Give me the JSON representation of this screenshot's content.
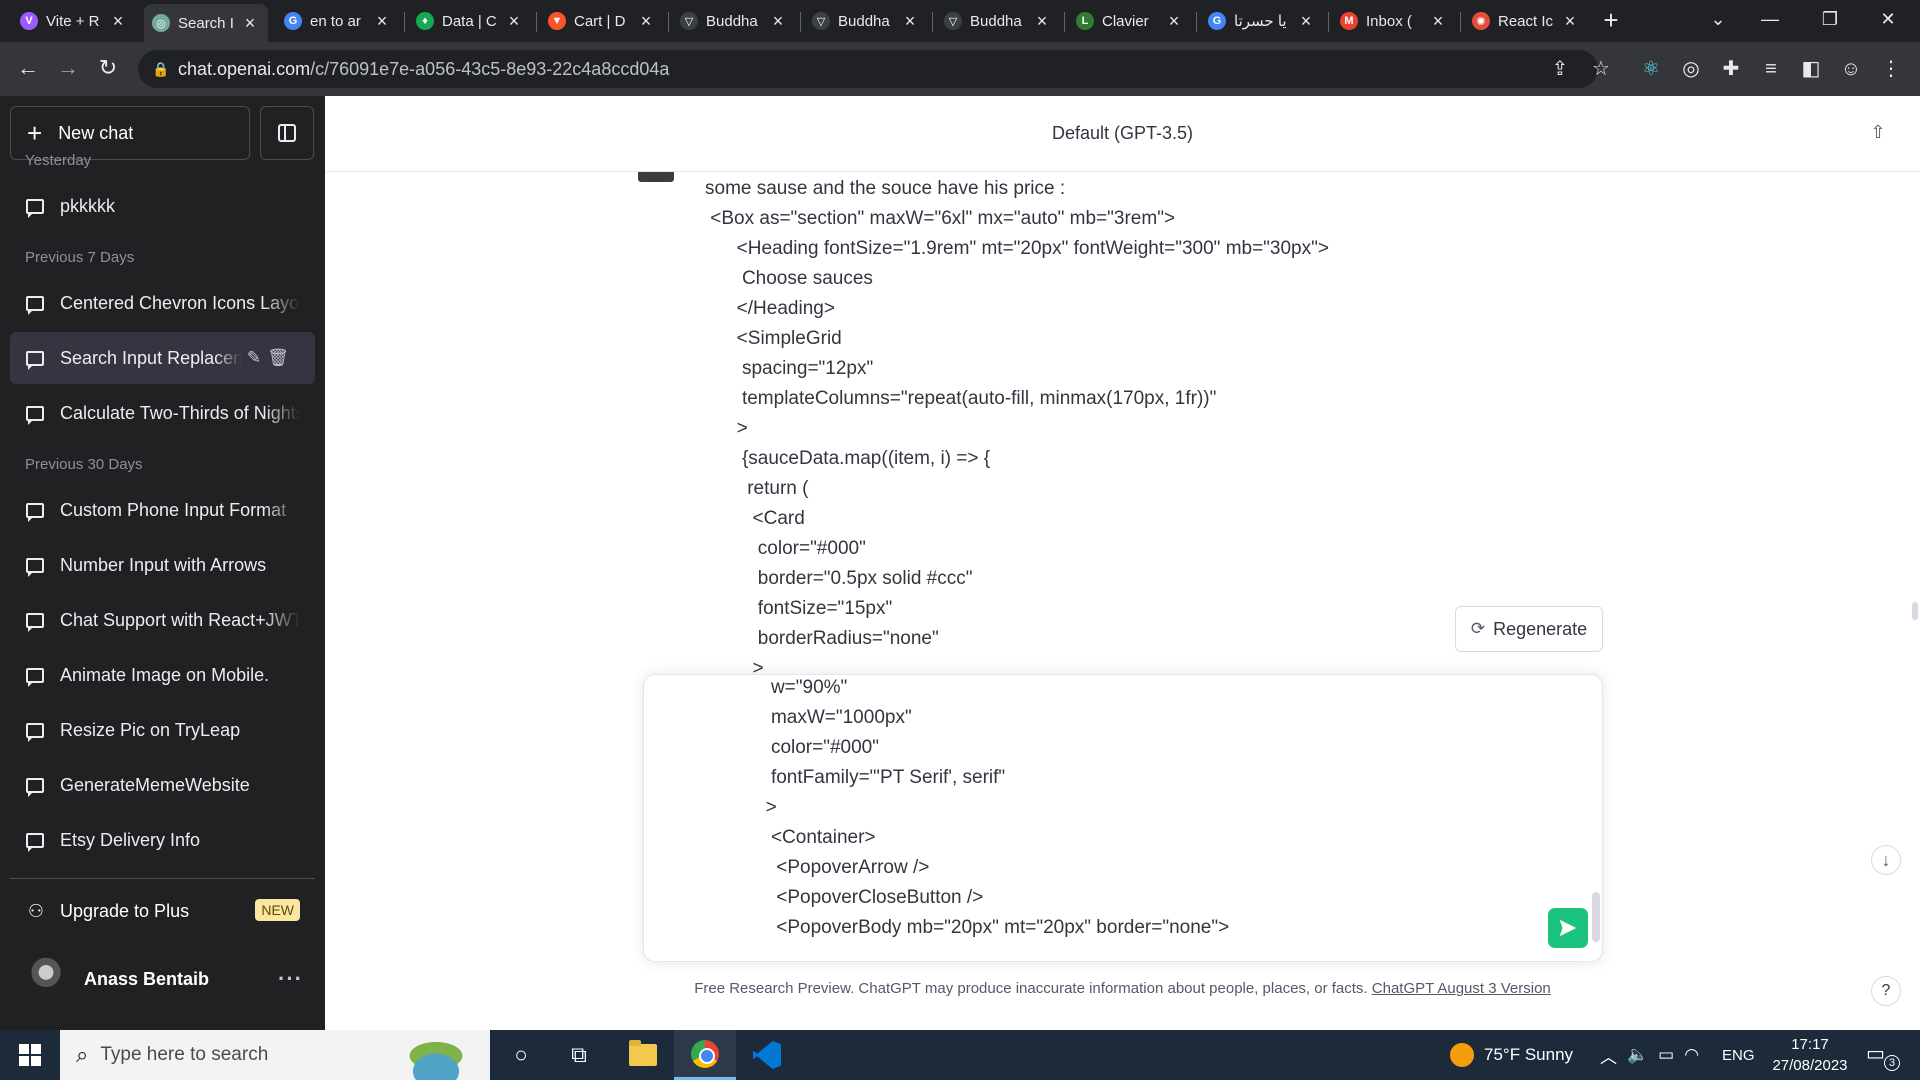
{
  "browser": {
    "tabs": [
      {
        "title": "Vite + R",
        "icon": "vite-icon",
        "color": "#9b5cff",
        "glyph": "V"
      },
      {
        "title": "Search I",
        "icon": "chatgpt-icon",
        "color": "#74aa9c",
        "glyph": "◎"
      },
      {
        "title": "en to ar",
        "icon": "google-icon",
        "color": "#4285f4",
        "glyph": "G"
      },
      {
        "title": "Data | C",
        "icon": "mongodb-icon",
        "color": "#13aa52",
        "glyph": "♦"
      },
      {
        "title": "Cart | D",
        "icon": "brave-icon",
        "color": "#fb542b",
        "glyph": "▼"
      },
      {
        "title": "Buddha",
        "icon": "buddha-icon",
        "color": "#3c4043",
        "glyph": "▽"
      },
      {
        "title": "Buddha",
        "icon": "buddha-icon",
        "color": "#3c4043",
        "glyph": "▽"
      },
      {
        "title": "Buddha",
        "icon": "buddha-icon",
        "color": "#3c4043",
        "glyph": "▽"
      },
      {
        "title": "Clavier",
        "icon": "clavier-icon",
        "color": "#2e7d32",
        "glyph": "L"
      },
      {
        "title": "يا حسرتا",
        "icon": "google-icon",
        "color": "#4285f4",
        "glyph": "G"
      },
      {
        "title": "Inbox (",
        "icon": "gmail-icon",
        "color": "#ea4335",
        "glyph": "M"
      },
      {
        "title": "React Ic",
        "icon": "react-icon",
        "color": "#e44d3a",
        "glyph": "✺"
      }
    ],
    "active_tab_index": 1,
    "url_host": "chat.openai.com",
    "url_path": "/c/76091e7e-a056-43c5-8e93-22c4a8ccd04a"
  },
  "sidebar": {
    "new_chat_label": "New chat",
    "groups": [
      {
        "title": "Yesterday",
        "items": [
          "pkkkkk"
        ]
      },
      {
        "title": "Previous 7 Days",
        "items": [
          "Centered Chevron Icons Layou",
          "Search Input Replacem",
          "Calculate Two-Thirds of Nights"
        ]
      },
      {
        "title": "Previous 30 Days",
        "items": [
          "Custom Phone Input Format",
          "Number Input with Arrows",
          "Chat Support with React+JWT",
          "Animate Image on Mobile.",
          "Resize Pic on TryLeap",
          "GenerateMemeWebsite",
          "Etsy Delivery Info"
        ]
      }
    ],
    "upgrade_label": "Upgrade to Plus",
    "upgrade_badge": "NEW",
    "user_name": "Anass Bentaib"
  },
  "main": {
    "model_label": "Default (GPT-3.5)",
    "message_lines": [
      "some sause and the souce have his price :",
      " <Box as=\"section\" maxW=\"6xl\" mx=\"auto\" mb=\"3rem\">",
      "      <Heading fontSize=\"1.9rem\" mt=\"20px\" fontWeight=\"300\" mb=\"30px\">",
      "       Choose sauces",
      "      </Heading>",
      "      <SimpleGrid",
      "       spacing=\"12px\"",
      "       templateColumns=\"repeat(auto-fill, minmax(170px, 1fr))\"",
      "      >",
      "       {sauceData.map((item, i) => {",
      "        return (",
      "         <Card",
      "          color=\"#000\"",
      "          border=\"0.5px solid #ccc\"",
      "          fontSize=\"15px\"",
      "          borderRadius=\"none\"",
      "         >"
    ],
    "regenerate_label": "Regenerate",
    "input_lines": [
      "       w=\"90%\"",
      "       maxW=\"1000px\"",
      "       color=\"#000\"",
      "       fontFamily=\"'PT Serif', serif\"",
      "      >",
      "       <Container>",
      "        <PopoverArrow />",
      "        <PopoverCloseButton />",
      "        <PopoverBody mb=\"20px\" mt=\"20px\" border=\"none\">"
    ],
    "footer_text": "Free Research Preview. ChatGPT may produce inaccurate information about people, places, or facts.",
    "footer_link": "ChatGPT August 3 Version",
    "help_label": "?"
  },
  "taskbar": {
    "search_placeholder": "Type here to search",
    "weather": "75°F  Sunny",
    "language": "ENG",
    "time": "17:17",
    "date": "27/08/2023",
    "notification_count": "3"
  },
  "colors": {
    "sidebar_bg": "#202123",
    "accent_send": "#19c37d",
    "selected_item": "#343541"
  }
}
